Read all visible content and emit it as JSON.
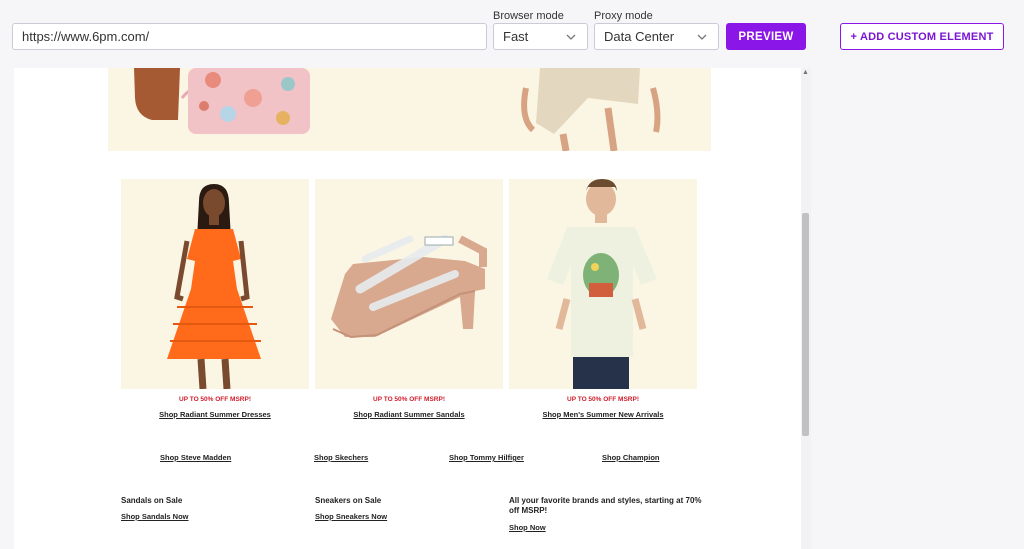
{
  "toolbar": {
    "url_value": "https://www.6pm.com/",
    "browser_mode_label": "Browser mode",
    "browser_mode_value": "Fast",
    "proxy_mode_label": "Proxy mode",
    "proxy_mode_value": "Data Center",
    "preview_label": "PREVIEW",
    "custom_element_label": "+ ADD CUSTOM ELEMENT"
  },
  "page": {
    "promos": [
      {
        "tag": "UP TO 50% OFF MSRP!",
        "link": "Shop Radiant Summer Dresses",
        "image_icon": "orange-dress-model"
      },
      {
        "tag": "UP TO 50% OFF MSRP!",
        "link": "Shop Radiant Summer Sandals",
        "image_icon": "clear-strap-sandal"
      },
      {
        "tag": "UP TO 50% OFF MSRP!",
        "link": "Shop Men's Summer New Arrivals",
        "image_icon": "graphic-tee-model"
      }
    ],
    "brands": [
      "Shop Steve Madden",
      "Shop Skechers",
      "Shop Tommy Hilfiger",
      "Shop Champion"
    ],
    "info": [
      {
        "title": "Sandals on Sale",
        "link": "Shop Sandals Now"
      },
      {
        "title": "Sneakers on Sale",
        "link": "Shop Sneakers Now"
      },
      {
        "title": "All your favorite brands and styles, starting at 70% off MSRP!",
        "link": "Shop Now"
      }
    ]
  },
  "colors": {
    "accent": "#8a17e8",
    "promo_tag": "#d01c2b",
    "promo_bg": "#fbf6e4"
  }
}
